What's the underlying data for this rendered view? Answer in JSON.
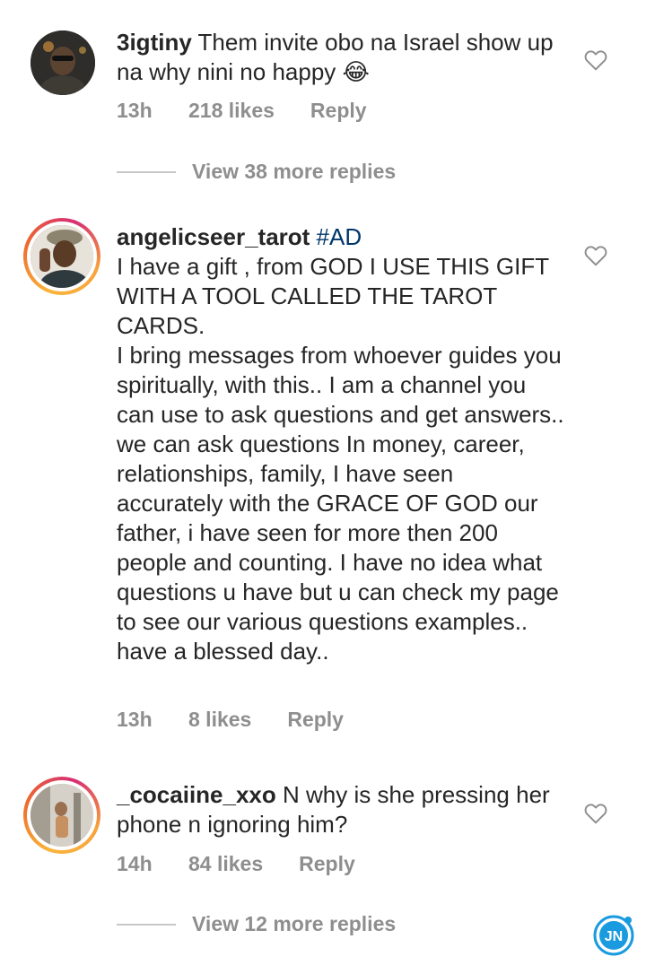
{
  "comments": [
    {
      "username": "3igtiny",
      "hashtag": "",
      "text": " Them invite obo na Israel show up na why nini no happy 😂",
      "time": "13h",
      "likes": "218 likes",
      "reply": "Reply",
      "view_replies": "View 38 more replies"
    },
    {
      "username": "angelicseer_tarot",
      "hashtag": " #AD",
      "text": "I have a gift , from GOD I USE THIS GIFT WITH A TOOL CALLED THE TAROT CARDS.\nI bring messages from whoever guides you spiritually, with this.. I am a channel you can use to ask questions and get answers..\nwe can ask questions In money, career, relationships, family, I have seen accurately with the GRACE OF GOD our father, i have seen for more then 200 people and counting. I have no idea what questions u have but u can check my page to see our various questions examples.. have a blessed day..",
      "time": "13h",
      "likes": "8 likes",
      "reply": "Reply"
    },
    {
      "username": "_cocaiine_xxo",
      "hashtag": "",
      "text": " N why is she pressing her phone n ignoring him?",
      "time": "14h",
      "likes": "84 likes",
      "reply": "Reply",
      "view_replies": "View 12 more replies"
    }
  ],
  "watermark": {
    "text": "JN"
  },
  "colors": {
    "username": "#262626",
    "hashtag": "#00376b",
    "meta": "#8e8e8e",
    "watermark": "#1a9be0"
  },
  "icons": {
    "like": "heart-outline-icon"
  }
}
